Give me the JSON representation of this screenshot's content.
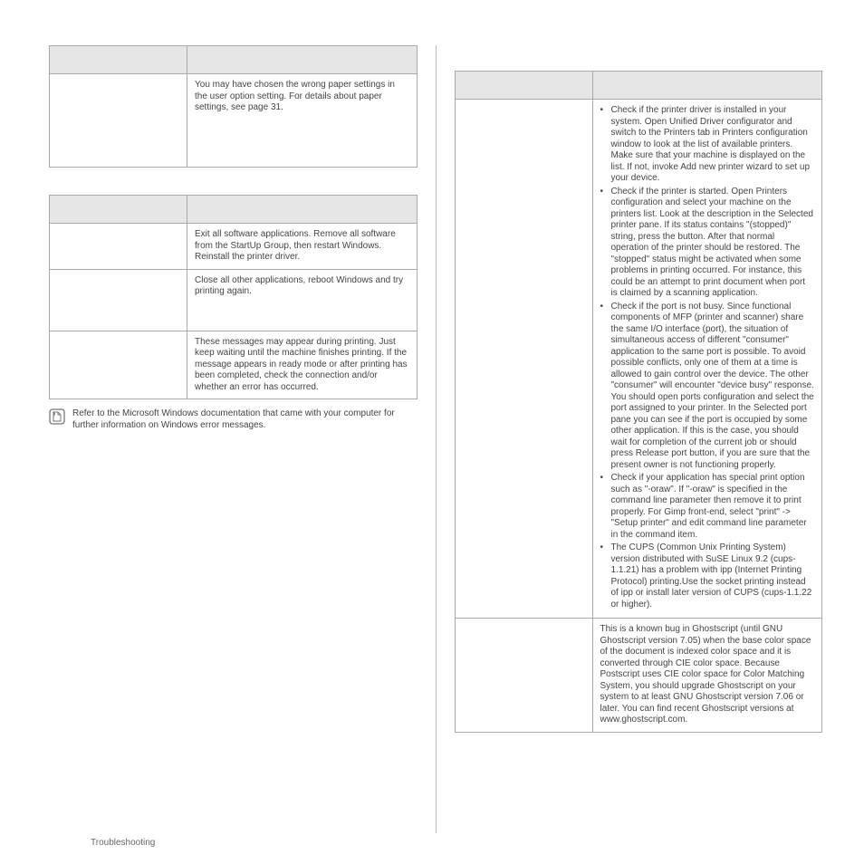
{
  "left": {
    "table1": {
      "header": [
        "",
        ""
      ],
      "rows": [
        {
          "problem": "",
          "solution": "You may have chosen the wrong paper settings in the user option setting. For details about paper settings, see page 31."
        }
      ]
    },
    "table2": {
      "header": [
        "",
        ""
      ],
      "rows": [
        {
          "problem": "",
          "solution": "Exit all software applications. Remove all software from the StartUp Group, then restart Windows. Reinstall the printer driver."
        },
        {
          "problem": "",
          "solution": "Close all other applications, reboot Windows and try printing again."
        },
        {
          "problem": "",
          "solution": "These messages may appear during printing. Just keep waiting until the machine finishes printing. If the message appears in ready mode or after printing has been completed, check the connection and/or whether an error has occurred."
        }
      ]
    },
    "note": "Refer to the Microsoft Windows documentation that came with your computer for further information on Windows error messages."
  },
  "right": {
    "table": {
      "header": [
        "",
        ""
      ],
      "rows": [
        {
          "problem": "",
          "bullets": [
            "Check if the printer driver is installed in your system. Open Unified Driver configurator and switch to the Printers tab in Printers configuration window to look at the list of available printers. Make sure that your machine is displayed on the list. If not, invoke Add new printer wizard to set up your device.",
            "Check if the printer is started. Open Printers configuration and select your machine on the printers list. Look at the description in the Selected printer pane. If its status contains \"(stopped)\" string,  press the            button. After that normal operation of the printer should be restored. The \"stopped\" status might be activated when some problems in printing occurred. For instance, this could be an attempt to print document when port is claimed by a scanning application.",
            "Check if the port is not busy. Since functional components of MFP (printer and scanner) share the same I/O interface (port), the situation of simultaneous access of different \"consumer\" application to the same port is possible. To avoid possible conflicts, only one of them at a time is allowed to gain control over the device. The other \"consumer\" will encounter \"device busy\" response. You should open ports configuration and select the port assigned to your printer. In the Selected port pane you can see if the port is occupied by some other application. If this is the case, you should wait for completion of the current job or should press Release port button, if you are sure that the present owner is not functioning properly.",
            "Check if your application has special print option such as \"-oraw\". If \"-oraw\" is specified in the command line parameter then remove it to print properly. For Gimp front-end, select \"print\" -> \"Setup printer\" and edit command line parameter in the command item.",
            "The CUPS (Common Unix Printing System) version distributed with SuSE Linux 9.2 (cups-1.1.21) has a problem with ipp (Internet Printing Protocol) printing.Use the socket printing instead of ipp or install later version of CUPS (cups-1.1.22 or higher)."
          ]
        },
        {
          "problem": "",
          "solution": "This is a known bug in Ghostscript (until GNU Ghostscript version 7.05) when the base color space of the document is indexed color space and it is converted through CIE color space. Because Postscript uses CIE color space for Color Matching System, you should upgrade Ghostscript on your system to at least GNU Ghostscript version 7.06 or later. You can find recent Ghostscript versions at www.ghostscript.com."
        }
      ]
    }
  },
  "footer": "Troubleshooting"
}
